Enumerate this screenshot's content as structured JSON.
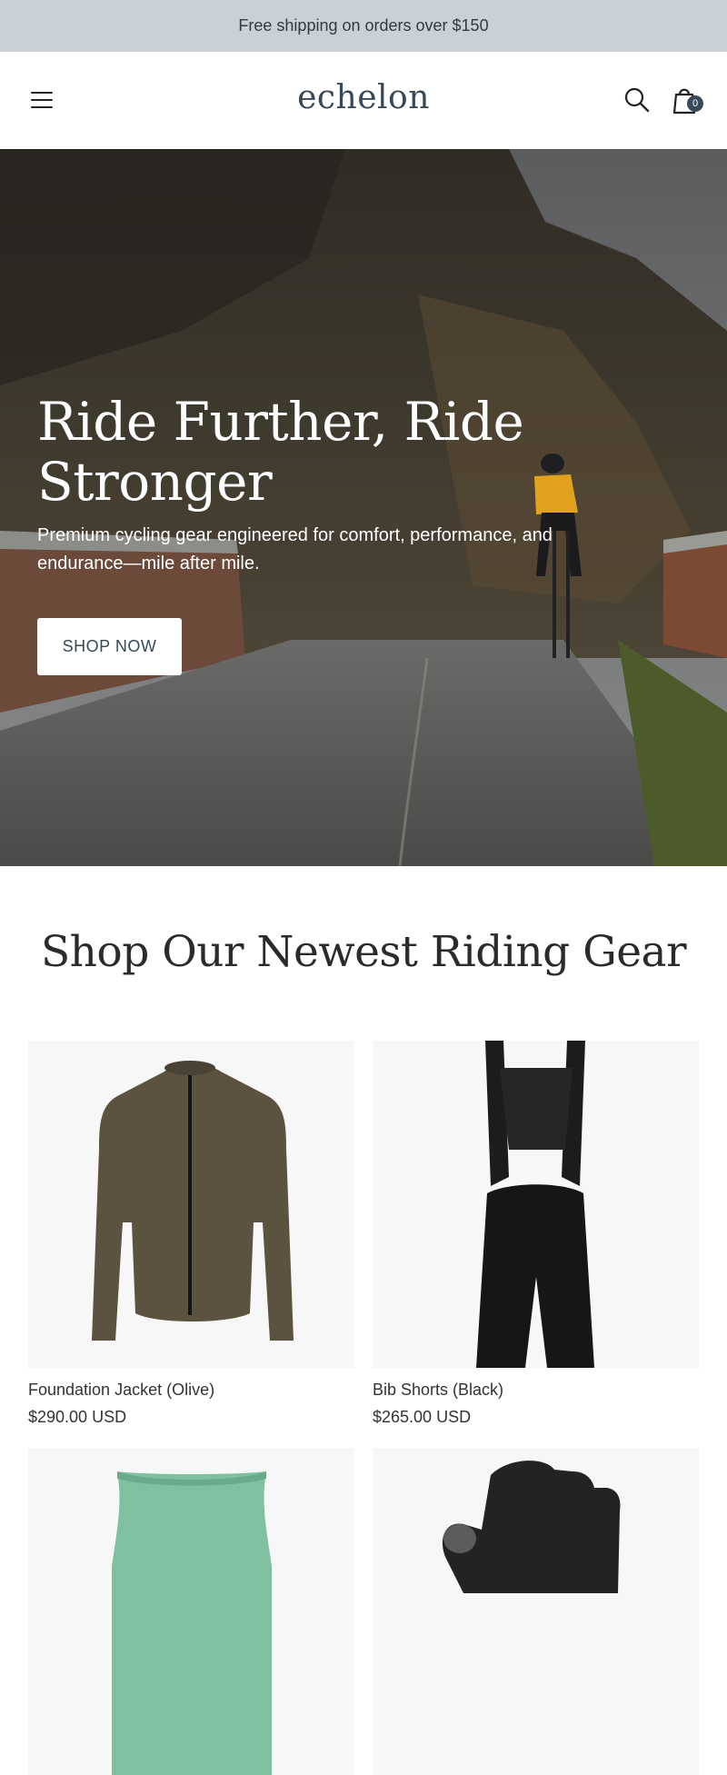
{
  "announcement": "Free shipping on orders over $150",
  "header": {
    "logo": "echelon",
    "cart_count": "0",
    "icons": [
      "menu-icon",
      "search-icon",
      "cart-icon"
    ]
  },
  "hero": {
    "title": "Ride Further, Ride Stronger",
    "subtitle": "Premium cycling gear engineered for comfort, performance, and endurance—mile after mile.",
    "cta": "SHOP NOW"
  },
  "section": {
    "title": "Shop Our Newest Riding Gear"
  },
  "products": [
    {
      "name": "Foundation Jacket (Olive)",
      "price": "$290.00 USD",
      "image": "olive-jacket"
    },
    {
      "name": "Bib Shorts (Black)",
      "price": "$265.00 USD",
      "image": "black-bib-shorts"
    },
    {
      "image": "mint-base-layer"
    },
    {
      "image": "black-cycling-gloves"
    }
  ],
  "colors": {
    "announcement_bg": "#c8d1d8",
    "brand": "#36495a",
    "jacket": "#5b5240",
    "baselayer": "#7fc0a0"
  }
}
